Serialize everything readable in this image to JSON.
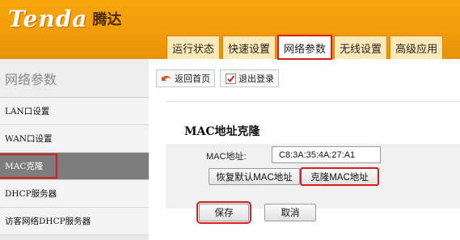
{
  "brand": {
    "logo_text": "Tenda",
    "logo_cn": "腾达"
  },
  "nav": {
    "tabs": [
      {
        "label": "运行状态"
      },
      {
        "label": "快速设置"
      },
      {
        "label": "网络参数"
      },
      {
        "label": "无线设置"
      },
      {
        "label": "高级应用"
      }
    ],
    "active_tab": "网络参数"
  },
  "sidebar": {
    "title": "网络参数",
    "items": [
      {
        "label": "LAN口设置"
      },
      {
        "label": "WAN口设置"
      },
      {
        "label": "MAC克隆"
      },
      {
        "label": "DHCP服务器"
      },
      {
        "label": "访客网络DHCP服务器"
      }
    ],
    "active_item": "MAC克隆"
  },
  "toolbar": {
    "home_label": "返回首页",
    "logout_label": "退出登录",
    "home_icon": "home-arrow-icon",
    "logout_icon": "logout-check-icon"
  },
  "panel": {
    "title": "MAC地址克隆",
    "mac_label": "MAC地址:",
    "mac_value": "C8:3A:35:4A:27:A1",
    "restore_label": "恢复默认MAC地址",
    "clone_label": "克隆MAC地址",
    "save_label": "保存",
    "cancel_label": "取消"
  },
  "colors": {
    "header_orange": "#f19c0a",
    "highlight_red": "#d81e1e",
    "active_sidebar": "#7d7d7d"
  }
}
